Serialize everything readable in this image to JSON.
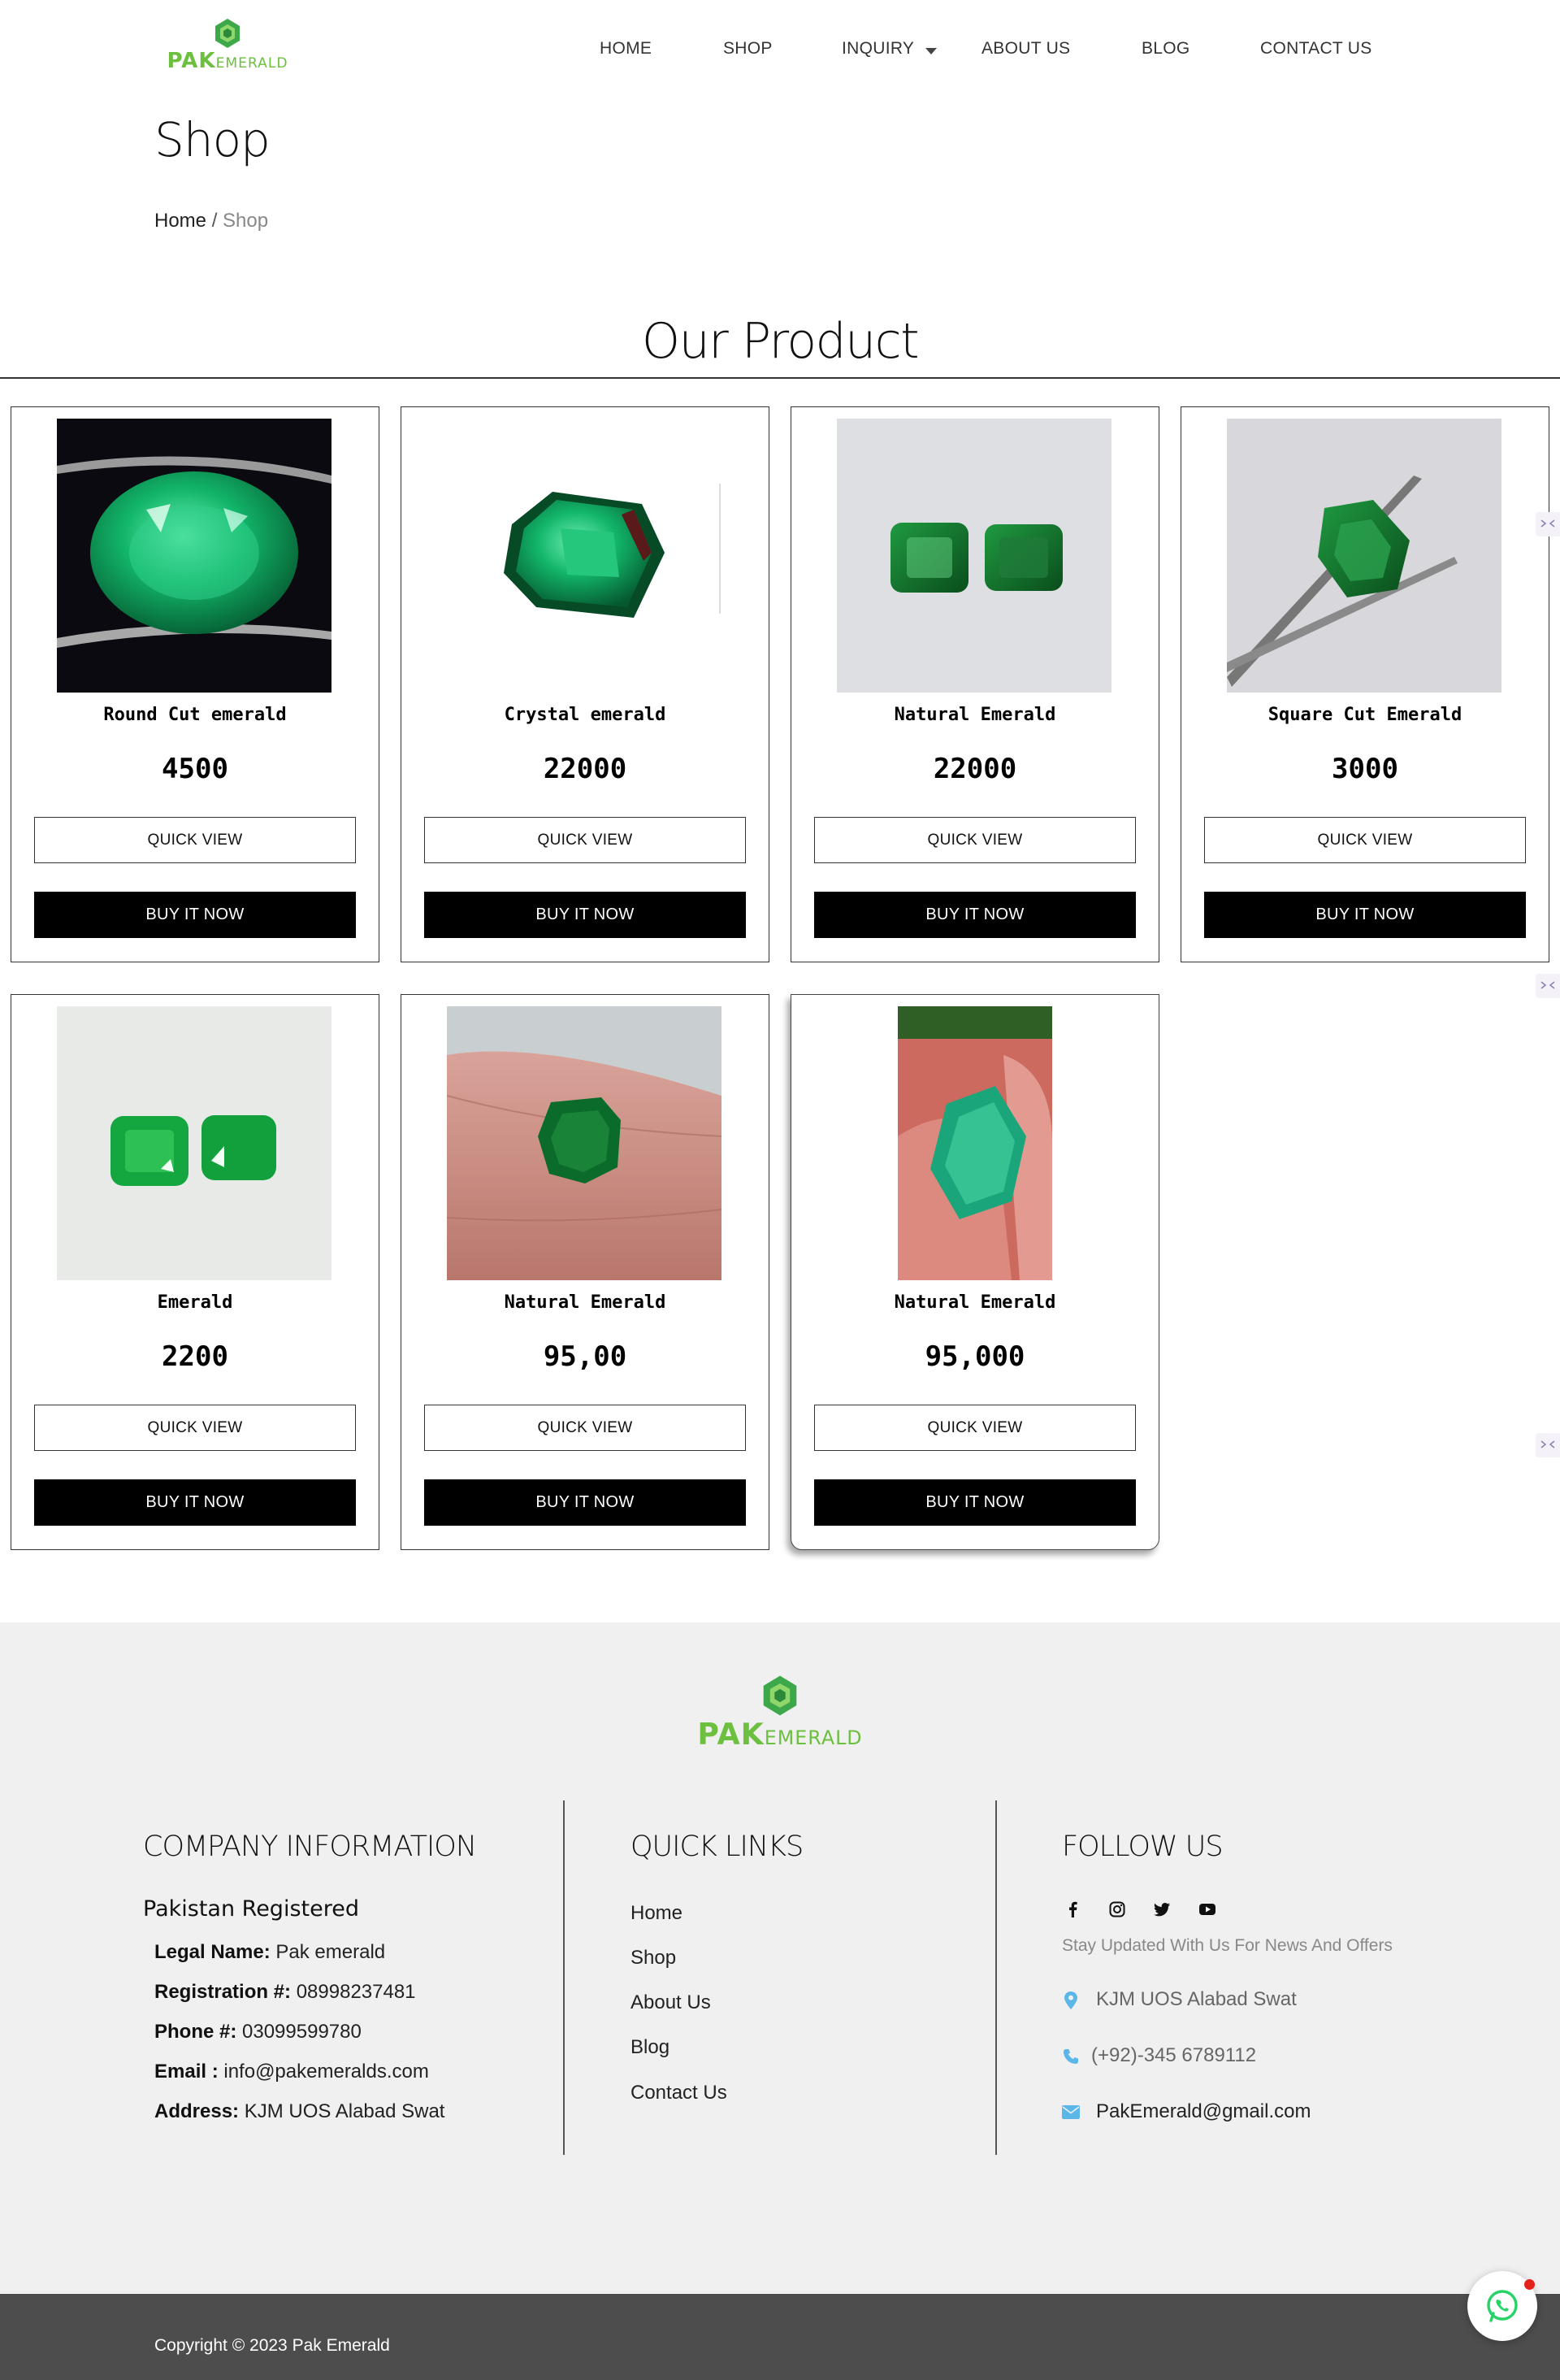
{
  "brand": {
    "primary": "PAK",
    "secondary": "EMERALD",
    "color": "#6cbf3f"
  },
  "nav": {
    "items": [
      {
        "label": "HOME"
      },
      {
        "label": "SHOP"
      },
      {
        "label": "INQUIRY"
      },
      {
        "label": "ABOUT US"
      },
      {
        "label": "BLOG"
      },
      {
        "label": "CONTACT US"
      }
    ]
  },
  "page": {
    "title": "Shop",
    "breadcrumb": {
      "home": "Home",
      "separator": "/",
      "current": "Shop"
    }
  },
  "section_title": "Our Product",
  "products": [
    {
      "name": "Round Cut emerald",
      "price": "4500",
      "quick_view": "QUICK VIEW",
      "buy": "BUY IT NOW"
    },
    {
      "name": "Crystal emerald",
      "price": "22000",
      "quick_view": "QUICK VIEW",
      "buy": "BUY IT NOW"
    },
    {
      "name": "Natural Emerald",
      "price": "22000",
      "quick_view": "QUICK VIEW",
      "buy": "BUY IT NOW"
    },
    {
      "name": "Square Cut Emerald",
      "price": "3000",
      "quick_view": "QUICK VIEW",
      "buy": "BUY IT NOW"
    },
    {
      "name": "Emerald",
      "price": "2200",
      "quick_view": "QUICK VIEW",
      "buy": "BUY IT NOW"
    },
    {
      "name": "Natural Emerald",
      "price": "95,00",
      "quick_view": "QUICK VIEW",
      "buy": "BUY IT NOW"
    },
    {
      "name": "Natural Emerald",
      "price": "95,000",
      "quick_view": "QUICK VIEW",
      "buy": "BUY IT NOW"
    }
  ],
  "footer": {
    "company": {
      "title": "COMPANY INFORMATION",
      "registered": "Pakistan Registered",
      "legal_label": "Legal Name:",
      "legal_value": "Pak emerald",
      "reg_label": "Registration #:",
      "reg_value": "08998237481",
      "phone_label": "Phone #:",
      "phone_value": "03099599780",
      "email_label": "Email :",
      "email_value": "info@pakemeralds.com",
      "address_label": "Address:",
      "address_value": "KJM UOS Alabad Swat"
    },
    "quick_links": {
      "title": "QUICK LINKS",
      "items": [
        {
          "label": "Home"
        },
        {
          "label": "Shop"
        },
        {
          "label": "About Us"
        },
        {
          "label": "Blog"
        },
        {
          "label": "Contact Us"
        }
      ]
    },
    "follow": {
      "title": "FOLLOW US",
      "subtitle": "Stay Updated With Us For News And Offers",
      "social_icons": [
        "facebook-icon",
        "instagram-icon",
        "twitter-icon",
        "youtube-icon"
      ],
      "address": "KJM UOS Alabad Swat",
      "phone": "(+92)-345 6789112",
      "email": "PakEmerald@gmail.com",
      "icon_color": "#5bb7e8"
    },
    "copyright": "Copyright © 2023 Pak Emerald"
  },
  "colors": {
    "footer_bg": "#f0f0f0",
    "bottom_bar": "#4d4d4d",
    "button_bg": "#000000",
    "whatsapp": "#25d366"
  }
}
